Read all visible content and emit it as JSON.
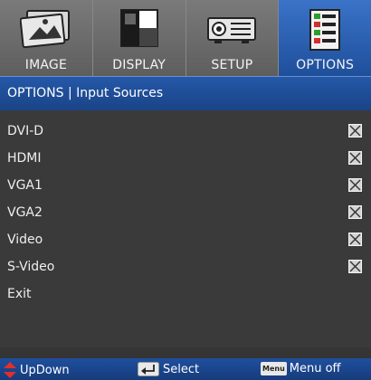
{
  "tabs": [
    {
      "label": "IMAGE",
      "icon": "image-icon",
      "active": false
    },
    {
      "label": "DISPLAY",
      "icon": "display-icon",
      "active": false
    },
    {
      "label": "SETUP",
      "icon": "setup-icon",
      "active": false
    },
    {
      "label": "OPTIONS",
      "icon": "options-icon",
      "active": true
    }
  ],
  "title": "OPTIONS | Input Sources",
  "items": [
    {
      "label": "DVI-D",
      "checked": true
    },
    {
      "label": "HDMI",
      "checked": true
    },
    {
      "label": "VGA1",
      "checked": true
    },
    {
      "label": "VGA2",
      "checked": true
    },
    {
      "label": "Video",
      "checked": true
    },
    {
      "label": "S-Video",
      "checked": true
    },
    {
      "label": "Exit"
    }
  ],
  "help": {
    "updown": "UpDown",
    "select": "Select",
    "menu_key": "Menu",
    "menu_off": "Menu off"
  },
  "colors": {
    "accent": "#2458a8",
    "active_tab": "#3b73c8",
    "updown_arrow": "#e0302a"
  }
}
